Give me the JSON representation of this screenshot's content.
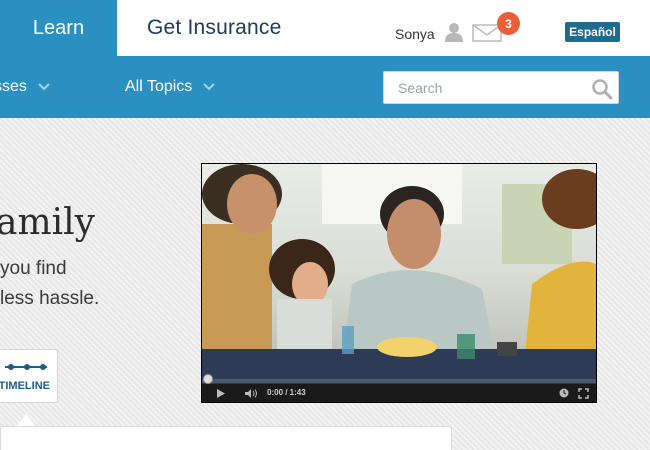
{
  "header": {
    "tabs": {
      "learn": "Learn",
      "get_insurance": "Get Insurance"
    },
    "user": {
      "name": "Sonya",
      "message_count": "3"
    },
    "language_button": "Español"
  },
  "nav": {
    "courses_label": "sses",
    "topics_label": "All Topics",
    "search_placeholder": "Search"
  },
  "hero": {
    "title": "amily",
    "line1": "you find",
    "line2": "less hassle."
  },
  "timeline": {
    "label": "TIMELINE"
  },
  "video": {
    "time": "0:00 / 1:43"
  },
  "colors": {
    "primary_blue": "#2a90c1",
    "dark_blue": "#1f6a8e",
    "badge_orange": "#ea5e38",
    "title_navy": "#1b3a5c"
  }
}
